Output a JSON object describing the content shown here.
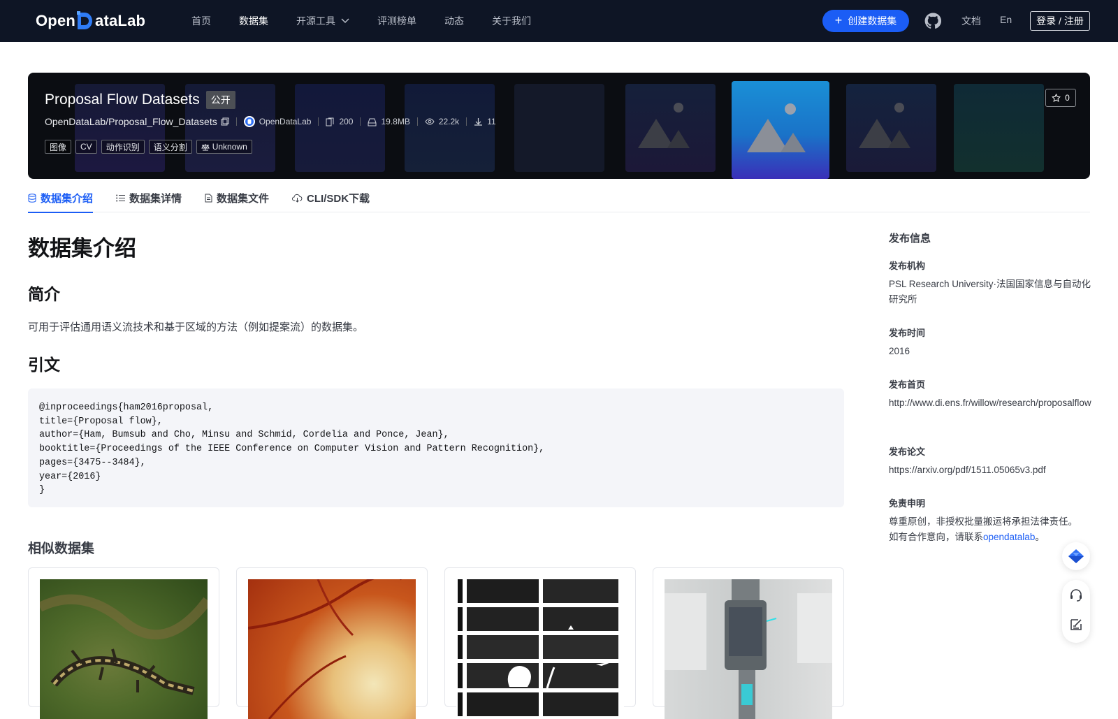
{
  "brand": {
    "logo_text_left": "Open",
    "logo_text_right": "ataLab"
  },
  "nav": {
    "items": [
      {
        "label": "首页"
      },
      {
        "label": "数据集",
        "active": true
      },
      {
        "label": "开源工具",
        "dropdown": true
      },
      {
        "label": "评测榜单"
      },
      {
        "label": "动态"
      },
      {
        "label": "关于我们"
      }
    ],
    "create_label": "创建数据集",
    "docs_label": "文档",
    "lang_label": "En",
    "login_label": "登录 / 注册"
  },
  "dataset": {
    "title": "Proposal Flow Datasets",
    "visibility": "公开",
    "repo": "OpenDataLab/Proposal_Flow_Datasets",
    "publisher": "OpenDataLab",
    "file_count": "200",
    "size": "19.8MB",
    "views": "22.2k",
    "downloads": "11",
    "tags": [
      "图像",
      "CV",
      "动作识别",
      "语义分割"
    ],
    "license": "Unknown",
    "stars": "0"
  },
  "tabs": [
    {
      "label": "数据集介绍",
      "active": true,
      "icon": "database-icon"
    },
    {
      "label": "数据集详情",
      "icon": "list-icon"
    },
    {
      "label": "数据集文件",
      "icon": "file-icon"
    },
    {
      "label": "CLI/SDK下载",
      "icon": "cloud-download-icon"
    }
  ],
  "content": {
    "heading": "数据集介绍",
    "intro_heading": "简介",
    "intro_text": "可用于评估通用语义流技术和基于区域的方法（例如提案流）的数据集。",
    "citation_heading": "引文",
    "citation_lines": [
      "@inproceedings{ham2016proposal,",
      "title={Proposal flow},",
      "author={Ham, Bumsub and Cho, Minsu and Schmid, Cordelia and Ponce, Jean},",
      "booktitle={Proceedings of the IEEE Conference on Computer Vision and Pattern Recognition},",
      "pages={3475--3484},",
      "year={2016}",
      "}"
    ],
    "similar_heading": "相似数据集"
  },
  "sidebar": {
    "title": "发布信息",
    "org_label": "发布机构",
    "org_value": "PSL Research University·法国国家信息与自动化研究所",
    "time_label": "发布时间",
    "time_value": "2016",
    "home_label": "发布首页",
    "home_value": "http://www.di.ens.fr/willow/research/proposalflow",
    "paper_label": "发布论文",
    "paper_value": "https://arxiv.org/pdf/1511.05065v3.pdf",
    "disclaimer_label": "免责申明",
    "disclaimer_line1": "尊重原创，非授权批量搬运将承担法律责任。",
    "disclaimer_line2_prefix": "如有合作意向，请联系",
    "disclaimer_link": "opendatalab",
    "disclaimer_line2_suffix": "。"
  },
  "colors": {
    "accent": "#1b5df5",
    "nav_bg": "#0e1525",
    "banner_bg": "#0b0d12"
  }
}
